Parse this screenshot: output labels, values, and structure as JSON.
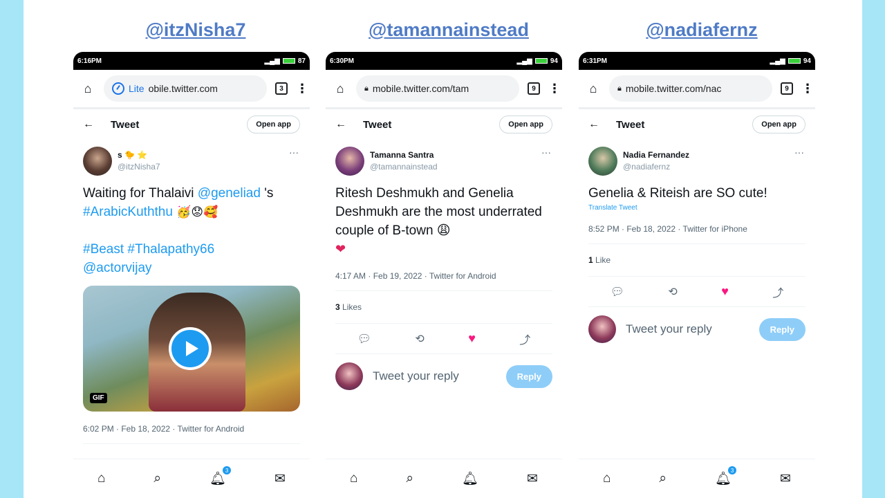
{
  "panels": [
    {
      "handle_title": "@itzNisha7",
      "status": {
        "time": "6:16PM",
        "battery": "87"
      },
      "browser": {
        "lite_label": "Lite",
        "url": "obile.twitter.com",
        "tab_count": "3"
      },
      "header": {
        "title": "Tweet",
        "open_app": "Open app"
      },
      "author": {
        "display": "s 🐤 ⭐",
        "handle": "@itzNisha7"
      },
      "tweet": {
        "text_plain": "Waiting for Thalaivi ",
        "mention": "@geneliad",
        "text_after": " 's",
        "hashtag1": "#ArabicKuththu",
        "emojis": "🥳😟🥰",
        "hashtags2": "#Beast #Thalapathy66",
        "mention2": "@actorvijay",
        "gif_label": "GIF"
      },
      "meta": "6:02 PM · Feb 18, 2022 · Twitter for Android",
      "notifications": "3"
    },
    {
      "handle_title": "@tamannainstead",
      "status": {
        "time": "6:30PM",
        "battery": "94"
      },
      "browser": {
        "url": "mobile.twitter.com/tam",
        "tab_count": "9"
      },
      "header": {
        "title": "Tweet",
        "open_app": "Open app"
      },
      "author": {
        "display": "Tamanna Santra",
        "handle": "@tamannainstead"
      },
      "tweet": {
        "text": "Ritesh Deshmukh and Genelia Deshmukh are the most underrated couple of B-town 😩",
        "heart": "❤"
      },
      "meta": "4:17 AM · Feb 19, 2022 · Twitter for Android",
      "likes_count": "3",
      "likes_label": " Likes",
      "reply_placeholder": "Tweet your reply",
      "reply_button": "Reply"
    },
    {
      "handle_title": "@nadiafernz",
      "status": {
        "time": "6:31PM",
        "battery": "94"
      },
      "browser": {
        "url": "mobile.twitter.com/nac",
        "tab_count": "9"
      },
      "header": {
        "title": "Tweet",
        "open_app": "Open app"
      },
      "author": {
        "display": "Nadia Fernandez",
        "handle": "@nadiafernz"
      },
      "tweet": {
        "text": "Genelia & Riteish are SO cute!",
        "translate": "Translate Tweet"
      },
      "meta": "8:52 PM · Feb 18, 2022 · Twitter for iPhone",
      "likes_count": "1",
      "likes_label": " Like",
      "reply_placeholder": "Tweet your reply",
      "reply_button": "Reply",
      "notifications": "3"
    }
  ]
}
